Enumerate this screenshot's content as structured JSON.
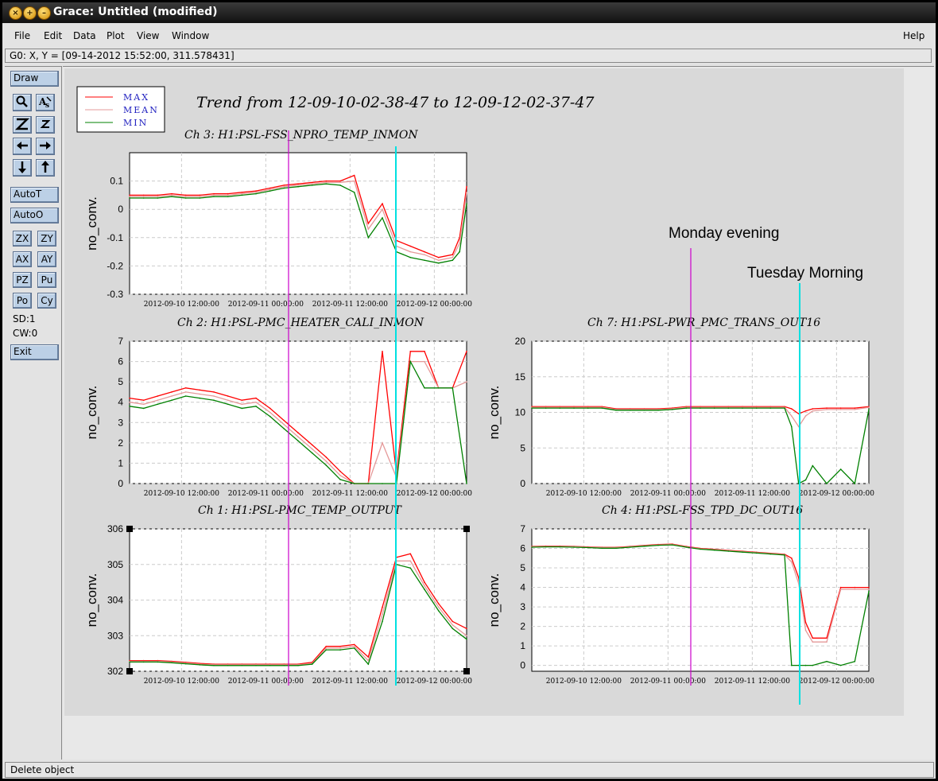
{
  "window": {
    "title": "Grace: Untitled (modified)",
    "location": "G0: X, Y = [09-14-2012 15:52:00, 311.578431]",
    "status": "Delete object"
  },
  "menu": [
    "File",
    "Edit",
    "Data",
    "Plot",
    "View",
    "Window",
    "Help"
  ],
  "toolbar": {
    "draw": "Draw",
    "autot": "AutoT",
    "autoo": "AutoO",
    "zx": "ZX",
    "zy": "ZY",
    "ax": "AX",
    "ay": "AY",
    "pz": "PZ",
    "pu": "Pu",
    "po": "Po",
    "cy": "Cy",
    "sd": "SD:1",
    "cw": "CW:0",
    "exit": "Exit",
    "icons": [
      "magnifier-icon",
      "autoscale-text-icon",
      "zoom-out-icon",
      "zoom-in-icon",
      "left-arrow-icon",
      "right-arrow-icon",
      "down-arrow-icon",
      "up-arrow-icon"
    ]
  },
  "colors": {
    "max": "#ff0000",
    "mean": "#e59a9a",
    "min": "#008000",
    "magenta_marker": "#cc00cc",
    "cyan_marker": "#00e0e0"
  },
  "legend": [
    "MAX",
    "MEAN",
    "MIN"
  ],
  "main_title": "Trend from 12-09-10-02-38-47 to 12-09-12-02-37-47",
  "annotations": {
    "monday": "Monday evening",
    "tuesday": "Tuesday Morning"
  },
  "chart_data": [
    {
      "type": "line",
      "title": "Ch 3: H1:PSL-FSS_NPRO_TEMP_INMON",
      "ylabel": "no_conv.",
      "ylim": [
        -0.3,
        0.2
      ],
      "yticks": [
        "-0.3",
        "-0.2",
        "-0.1",
        "0",
        "0.1"
      ],
      "xticks": [
        "2012-09-10 12:00:00",
        "2012-09-11 00:00:00",
        "2012-09-11 12:00:00",
        "2012-09-12 00:00:00"
      ],
      "x": [
        0,
        2,
        4,
        6,
        8,
        10,
        12,
        14,
        16,
        18,
        20,
        22,
        24,
        26,
        28,
        30,
        32,
        34,
        36,
        38,
        40,
        42,
        44,
        46,
        47,
        48
      ],
      "series": [
        {
          "name": "MAX",
          "values": [
            0.05,
            0.05,
            0.05,
            0.055,
            0.05,
            0.05,
            0.055,
            0.055,
            0.06,
            0.065,
            0.075,
            0.085,
            0.09,
            0.095,
            0.1,
            0.1,
            0.12,
            -0.05,
            0.02,
            -0.11,
            -0.13,
            -0.15,
            -0.17,
            -0.16,
            -0.1,
            0.08
          ]
        },
        {
          "name": "MEAN",
          "values": [
            0.045,
            0.045,
            0.045,
            0.05,
            0.045,
            0.045,
            0.05,
            0.05,
            0.055,
            0.06,
            0.07,
            0.08,
            0.085,
            0.09,
            0.095,
            0.095,
            0.1,
            -0.07,
            0.0,
            -0.13,
            -0.15,
            -0.16,
            -0.18,
            -0.17,
            -0.12,
            0.06
          ]
        },
        {
          "name": "MIN",
          "values": [
            0.04,
            0.04,
            0.04,
            0.045,
            0.04,
            0.04,
            0.045,
            0.045,
            0.05,
            0.055,
            0.065,
            0.075,
            0.08,
            0.085,
            0.09,
            0.085,
            0.06,
            -0.1,
            -0.03,
            -0.15,
            -0.17,
            -0.18,
            -0.19,
            -0.18,
            -0.15,
            0.02
          ]
        }
      ]
    },
    {
      "type": "line",
      "title": "Ch 2: H1:PSL-PMC_HEATER_CALI_INMON",
      "ylabel": "no_conv.",
      "ylim": [
        0,
        7
      ],
      "yticks": [
        "0",
        "1",
        "2",
        "3",
        "4",
        "5",
        "6",
        "7"
      ],
      "xticks": [
        "2012-09-10 12:00:00",
        "2012-09-11 00:00:00",
        "2012-09-11 12:00:00",
        "2012-09-12 00:00:00"
      ],
      "x": [
        0,
        2,
        4,
        6,
        8,
        10,
        12,
        14,
        16,
        18,
        20,
        22,
        24,
        26,
        28,
        30,
        32,
        34,
        36,
        38,
        40,
        42,
        44,
        46,
        48
      ],
      "series": [
        {
          "name": "MAX",
          "values": [
            4.2,
            4.1,
            4.3,
            4.5,
            4.7,
            4.6,
            4.5,
            4.3,
            4.1,
            4.2,
            3.7,
            3.1,
            2.5,
            1.9,
            1.3,
            0.6,
            0,
            0,
            6.5,
            0.5,
            6.5,
            6.5,
            4.7,
            4.7,
            6.5
          ]
        },
        {
          "name": "MEAN",
          "values": [
            4.0,
            3.9,
            4.1,
            4.3,
            4.5,
            4.4,
            4.3,
            4.1,
            3.9,
            4.0,
            3.5,
            2.9,
            2.3,
            1.7,
            1.1,
            0.4,
            0,
            0,
            2.0,
            0.3,
            6.0,
            6.0,
            4.7,
            4.7,
            5.0
          ]
        },
        {
          "name": "MIN",
          "values": [
            3.8,
            3.7,
            3.9,
            4.1,
            4.3,
            4.2,
            4.1,
            3.9,
            3.7,
            3.8,
            3.3,
            2.7,
            2.1,
            1.5,
            0.9,
            0.2,
            0,
            0,
            0,
            0,
            6.0,
            4.7,
            4.7,
            4.7,
            0
          ]
        }
      ]
    },
    {
      "type": "line",
      "title": "Ch 1: H1:PSL-PMC_TEMP_OUTPUT",
      "ylabel": "no_conv.",
      "ylim": [
        302,
        306
      ],
      "yticks": [
        "302",
        "303",
        "304",
        "305",
        "306"
      ],
      "xticks": [
        "2012-09-10 12:00:00",
        "2012-09-11 00:00:00",
        "2012-09-11 12:00:00",
        "2012-09-12 00:00:00"
      ],
      "x": [
        0,
        2,
        4,
        6,
        8,
        10,
        12,
        14,
        16,
        18,
        20,
        22,
        24,
        26,
        28,
        30,
        32,
        34,
        36,
        38,
        40,
        42,
        44,
        46,
        48
      ],
      "series": [
        {
          "name": "MAX",
          "values": [
            302.3,
            302.3,
            302.3,
            302.28,
            302.25,
            302.22,
            302.2,
            302.2,
            302.2,
            302.2,
            302.2,
            302.2,
            302.2,
            302.25,
            302.7,
            302.7,
            302.75,
            302.4,
            303.8,
            305.2,
            305.3,
            304.5,
            303.9,
            303.4,
            303.2
          ]
        },
        {
          "name": "MEAN",
          "values": [
            302.28,
            302.28,
            302.28,
            302.26,
            302.23,
            302.2,
            302.18,
            302.18,
            302.18,
            302.18,
            302.18,
            302.18,
            302.18,
            302.22,
            302.65,
            302.65,
            302.7,
            302.3,
            303.6,
            305.1,
            305.1,
            304.4,
            303.8,
            303.3,
            303.0
          ]
        },
        {
          "name": "MIN",
          "values": [
            302.26,
            302.26,
            302.26,
            302.24,
            302.21,
            302.18,
            302.16,
            302.16,
            302.16,
            302.16,
            302.16,
            302.16,
            302.16,
            302.2,
            302.6,
            302.6,
            302.65,
            302.2,
            303.4,
            305.0,
            304.9,
            304.3,
            303.7,
            303.2,
            302.9
          ]
        }
      ]
    },
    {
      "type": "line",
      "title": "Ch 7: H1:PSL-PWR_PMC_TRANS_OUT16",
      "ylabel": "no_conv.",
      "ylim": [
        0,
        20
      ],
      "yticks": [
        "0",
        "5",
        "10",
        "15",
        "20"
      ],
      "xticks": [
        "2012-09-10 12:00:00",
        "2012-09-11 00:00:00",
        "2012-09-11 12:00:00",
        "2012-09-12 00:00:00"
      ],
      "x": [
        0,
        2,
        4,
        6,
        8,
        10,
        12,
        14,
        16,
        18,
        20,
        22,
        24,
        26,
        28,
        30,
        32,
        34,
        36,
        37,
        38,
        39,
        40,
        42,
        44,
        46,
        48
      ],
      "series": [
        {
          "name": "MAX",
          "values": [
            10.8,
            10.8,
            10.8,
            10.8,
            10.8,
            10.8,
            10.5,
            10.5,
            10.5,
            10.5,
            10.6,
            10.8,
            10.8,
            10.8,
            10.8,
            10.8,
            10.8,
            10.8,
            10.8,
            10.5,
            9.8,
            10.2,
            10.5,
            10.6,
            10.6,
            10.6,
            10.8
          ]
        },
        {
          "name": "MEAN",
          "values": [
            10.7,
            10.7,
            10.7,
            10.7,
            10.7,
            10.7,
            10.4,
            10.4,
            10.4,
            10.4,
            10.5,
            10.7,
            10.7,
            10.7,
            10.7,
            10.7,
            10.7,
            10.7,
            10.7,
            9.5,
            8.0,
            9.5,
            10.2,
            10.4,
            10.4,
            10.4,
            10.7
          ]
        },
        {
          "name": "MIN",
          "values": [
            10.6,
            10.6,
            10.6,
            10.6,
            10.6,
            10.6,
            10.3,
            10.3,
            10.3,
            10.3,
            10.4,
            10.6,
            10.6,
            10.6,
            10.6,
            10.6,
            10.6,
            10.6,
            10.6,
            8.0,
            0,
            0.5,
            2.5,
            0,
            2,
            0,
            10.4
          ]
        }
      ]
    },
    {
      "type": "line",
      "title": "Ch 4: H1:PSL-FSS_TPD_DC_OUT16",
      "ylabel": "no_conv.",
      "ylim": [
        -0.3,
        7
      ],
      "yticks": [
        "0",
        "1",
        "2",
        "3",
        "4",
        "5",
        "6",
        "7"
      ],
      "xticks": [
        "2012-09-10 12:00:00",
        "2012-09-11 00:00:00",
        "2012-09-11 12:00:00",
        "2012-09-12 00:00:00"
      ],
      "x": [
        0,
        2,
        4,
        6,
        8,
        10,
        12,
        14,
        16,
        18,
        20,
        22,
        24,
        26,
        28,
        30,
        32,
        34,
        36,
        37,
        38,
        39,
        40,
        42,
        44,
        46,
        48
      ],
      "series": [
        {
          "name": "MAX",
          "values": [
            6.1,
            6.12,
            6.12,
            6.1,
            6.08,
            6.05,
            6.05,
            6.1,
            6.15,
            6.2,
            6.22,
            6.1,
            6.0,
            5.95,
            5.9,
            5.85,
            5.8,
            5.75,
            5.7,
            5.5,
            4.5,
            2.2,
            1.4,
            1.4,
            4.0,
            4.0,
            4.0
          ]
        },
        {
          "name": "MEAN",
          "values": [
            6.08,
            6.1,
            6.1,
            6.08,
            6.06,
            6.03,
            6.03,
            6.08,
            6.13,
            6.18,
            6.2,
            6.08,
            5.98,
            5.93,
            5.88,
            5.83,
            5.78,
            5.73,
            5.68,
            5.3,
            4.2,
            1.8,
            1.2,
            1.2,
            3.9,
            3.9,
            3.9
          ]
        },
        {
          "name": "MIN",
          "values": [
            6.06,
            6.08,
            6.08,
            6.06,
            6.04,
            6.01,
            6.01,
            6.06,
            6.11,
            6.16,
            6.18,
            6.06,
            5.96,
            5.91,
            5.86,
            5.81,
            5.76,
            5.71,
            5.66,
            0,
            0,
            0,
            0,
            0.2,
            0,
            0.2,
            3.8
          ]
        }
      ]
    }
  ]
}
